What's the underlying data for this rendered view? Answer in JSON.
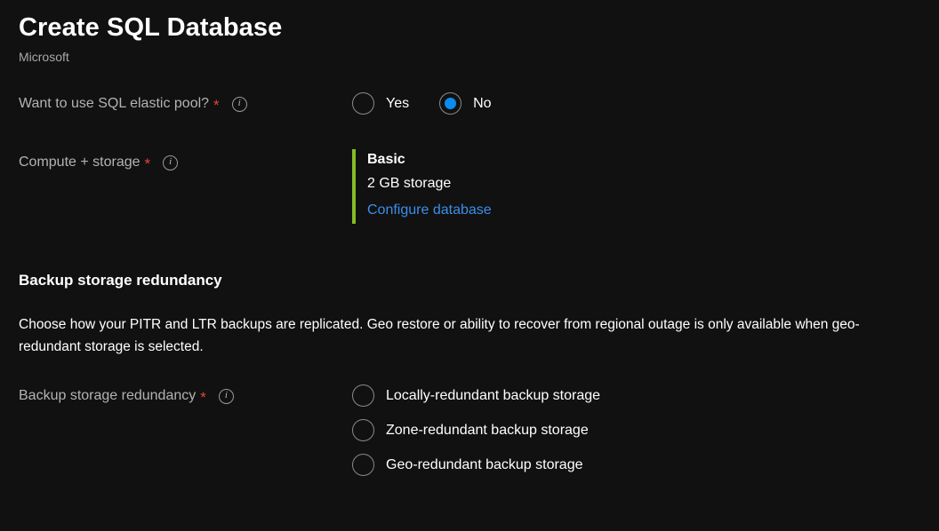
{
  "header": {
    "title": "Create SQL Database",
    "publisher": "Microsoft"
  },
  "fields": {
    "elastic_pool": {
      "label": "Want to use SQL elastic pool?",
      "required_mark": "*",
      "info_icon": "info-icon",
      "info_glyph": "i",
      "options": [
        {
          "label": "Yes",
          "selected": false
        },
        {
          "label": "No",
          "selected": true
        }
      ]
    },
    "compute_storage": {
      "label": "Compute + storage",
      "required_mark": "*",
      "info_icon": "info-icon",
      "info_glyph": "i",
      "tier_name": "Basic",
      "tier_storage": "2 GB storage",
      "configure_link": "Configure database",
      "accent_color": "#86bc25",
      "link_color": "#3b8eea"
    }
  },
  "backup_section": {
    "heading": "Backup storage redundancy",
    "description": "Choose how your PITR and LTR backups are replicated. Geo restore or ability to recover from regional outage is only available when geo-redundant storage is selected.",
    "field": {
      "label": "Backup storage redundancy",
      "required_mark": "*",
      "info_icon": "info-icon",
      "info_glyph": "i",
      "options": [
        {
          "label": "Locally-redundant backup storage",
          "selected": false
        },
        {
          "label": "Zone-redundant backup storage",
          "selected": false
        },
        {
          "label": "Geo-redundant backup storage",
          "selected": false
        }
      ]
    }
  },
  "colors": {
    "background": "#111111",
    "accent_blue": "#0a8cf0",
    "required_red": "#e3453c",
    "label_gray": "#b3b3b3"
  }
}
